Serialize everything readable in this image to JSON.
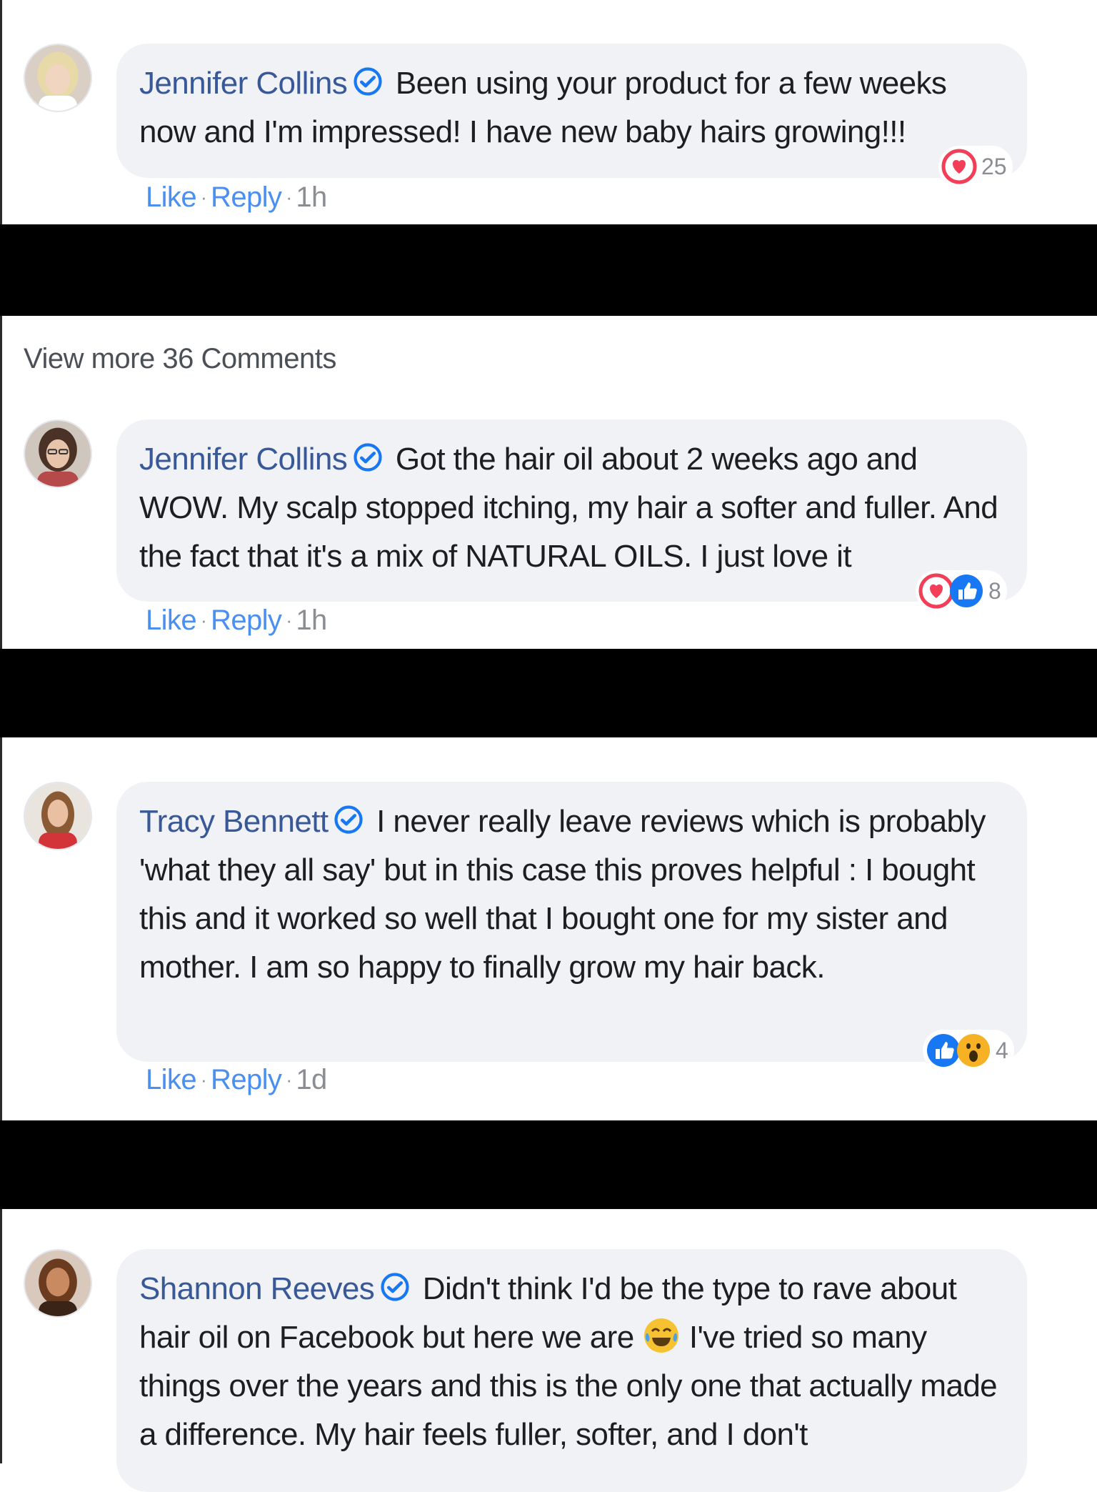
{
  "comments": [
    {
      "author": "Jennifer Collins",
      "text": "Been using your product for a few weeks now and I'm impressed! I have new baby hairs growing!!!",
      "actions": {
        "like": "Like",
        "reply": "Reply",
        "time": "1h"
      },
      "reactions": [
        "love"
      ],
      "reaction_count": "25"
    },
    {
      "author": "Jennifer Collins",
      "text": "Got the hair oil about 2 weeks ago and WOW. My scalp stopped itching, my hair a softer and fuller. And the fact that it's a mix of NATURAL OILS. I just love it",
      "actions": {
        "like": "Like",
        "reply": "Reply",
        "time": "1h"
      },
      "reactions": [
        "love",
        "like"
      ],
      "reaction_count": "8"
    },
    {
      "author": "Tracy Bennett",
      "text": "I never really leave reviews which is probably 'what they all say' but in this case this proves helpful : I bought this and it worked so well that I bought one for my sister and mother. I am so happy to finally grow my hair back.",
      "actions": {
        "like": "Like",
        "reply": "Reply",
        "time": "1d"
      },
      "reactions": [
        "like",
        "wow"
      ],
      "reaction_count": "4"
    },
    {
      "author": "Shannon Reeves",
      "text_before_emoji": "Didn't think I'd be the type to rave about hair oil on Facebook but here we are",
      "text_after_emoji": "I've tried so many things over the years and this is the only one that actually made a difference. My hair feels fuller, softer, and I don't",
      "emoji": "crying-laughing-emoji"
    }
  ],
  "view_more": "View more 36 Comments",
  "colors": {
    "author": "#385898",
    "bubble": "#f0f2f5",
    "link": "#4b8ff0",
    "verified": "#1877f2",
    "love": "#f33e58",
    "separator": "#000000"
  }
}
